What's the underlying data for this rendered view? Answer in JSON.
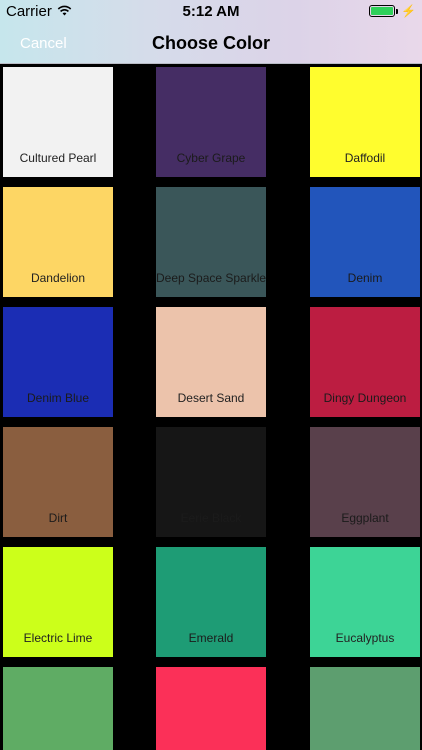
{
  "status_bar": {
    "carrier": "Carrier",
    "time": "5:12 AM"
  },
  "nav": {
    "cancel_label": "Cancel",
    "title": "Choose Color"
  },
  "colors": [
    {
      "name": "Cultured Pearl",
      "hex": "#f2f2f2",
      "label_color": "#222222"
    },
    {
      "name": "Cyber Grape",
      "hex": "#452d64",
      "label_color": "#1b1b1b"
    },
    {
      "name": "Daffodil",
      "hex": "#fffd2e",
      "label_color": "#222222"
    },
    {
      "name": "Dandelion",
      "hex": "#fdd664",
      "label_color": "#222222"
    },
    {
      "name": "Deep Space Sparkle",
      "hex": "#3a5659",
      "label_color": "#1b1b1b"
    },
    {
      "name": "Denim",
      "hex": "#2255bb",
      "label_color": "#1b1b1b"
    },
    {
      "name": "Denim Blue",
      "hex": "#1b2db4",
      "label_color": "#1b1b1b"
    },
    {
      "name": "Desert Sand",
      "hex": "#ecc3ab",
      "label_color": "#222222"
    },
    {
      "name": "Dingy Dungeon",
      "hex": "#bc1d41",
      "label_color": "#1b1b1b"
    },
    {
      "name": "Dirt",
      "hex": "#8a5e3f",
      "label_color": "#1b1b1b"
    },
    {
      "name": "Eerie Black",
      "hex": "#161616",
      "label_color": "#1b1b1b"
    },
    {
      "name": "Eggplant",
      "hex": "#59404b",
      "label_color": "#1b1b1b"
    },
    {
      "name": "Electric Lime",
      "hex": "#ccff1a",
      "label_color": "#222222"
    },
    {
      "name": "Emerald",
      "hex": "#1e9c75",
      "label_color": "#1b1b1b"
    },
    {
      "name": "Eucalyptus",
      "hex": "#3dd496",
      "label_color": "#222222"
    },
    {
      "name": "",
      "hex": "#5fac64",
      "label_color": "#222222"
    },
    {
      "name": "",
      "hex": "#fb3058",
      "label_color": "#222222"
    },
    {
      "name": "",
      "hex": "#5d9e6f",
      "label_color": "#222222"
    }
  ]
}
